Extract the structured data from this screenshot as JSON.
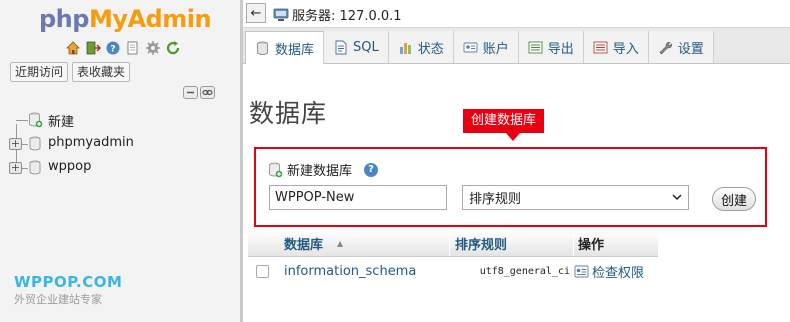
{
  "logo": {
    "php": "php",
    "myadmin": "MyAdmin"
  },
  "nav_icons": [
    "home-icon",
    "exit-icon",
    "help-icon",
    "docs-icon",
    "settings-icon",
    "reload-icon"
  ],
  "recent_tabs": {
    "recent": "近期访问",
    "favorites": "表收藏夹"
  },
  "tree": {
    "new_label": "新建",
    "databases": [
      "phpmyadmin",
      "wppop"
    ]
  },
  "watermark": {
    "title": "WPPOP.COM",
    "subtitle": "外贸企业建站专家"
  },
  "topbar": {
    "back_label": "←",
    "server_label": "服务器: 127.0.0.1"
  },
  "tabs": [
    {
      "label": "数据库",
      "icon": "database-icon",
      "active": true
    },
    {
      "label": "SQL",
      "icon": "sql-icon",
      "active": false
    },
    {
      "label": "状态",
      "icon": "status-chart-icon",
      "active": false
    },
    {
      "label": "账户",
      "icon": "accounts-icon",
      "active": false
    },
    {
      "label": "导出",
      "icon": "export-icon",
      "active": false
    },
    {
      "label": "导入",
      "icon": "import-icon",
      "active": false
    },
    {
      "label": "设置",
      "icon": "wrench-icon",
      "active": false
    }
  ],
  "main": {
    "title": "数据库",
    "callout": "创建数据库",
    "create": {
      "header": "新建数据库",
      "help": "?",
      "dbname_value": "WPPOP-New",
      "collation_value": "排序规则",
      "create_button": "创建"
    },
    "table": {
      "headers": {
        "database": "数据库",
        "collation": "排序规则",
        "action": "操作"
      },
      "rows": [
        {
          "database": "information_schema",
          "collation": "utf8_general_ci",
          "action": "检查权限"
        }
      ]
    }
  },
  "colors": {
    "accent_red": "#e60012",
    "link_blue": "#235a81",
    "logo_blue": "#6c78af",
    "logo_orange": "#f89c0e"
  }
}
